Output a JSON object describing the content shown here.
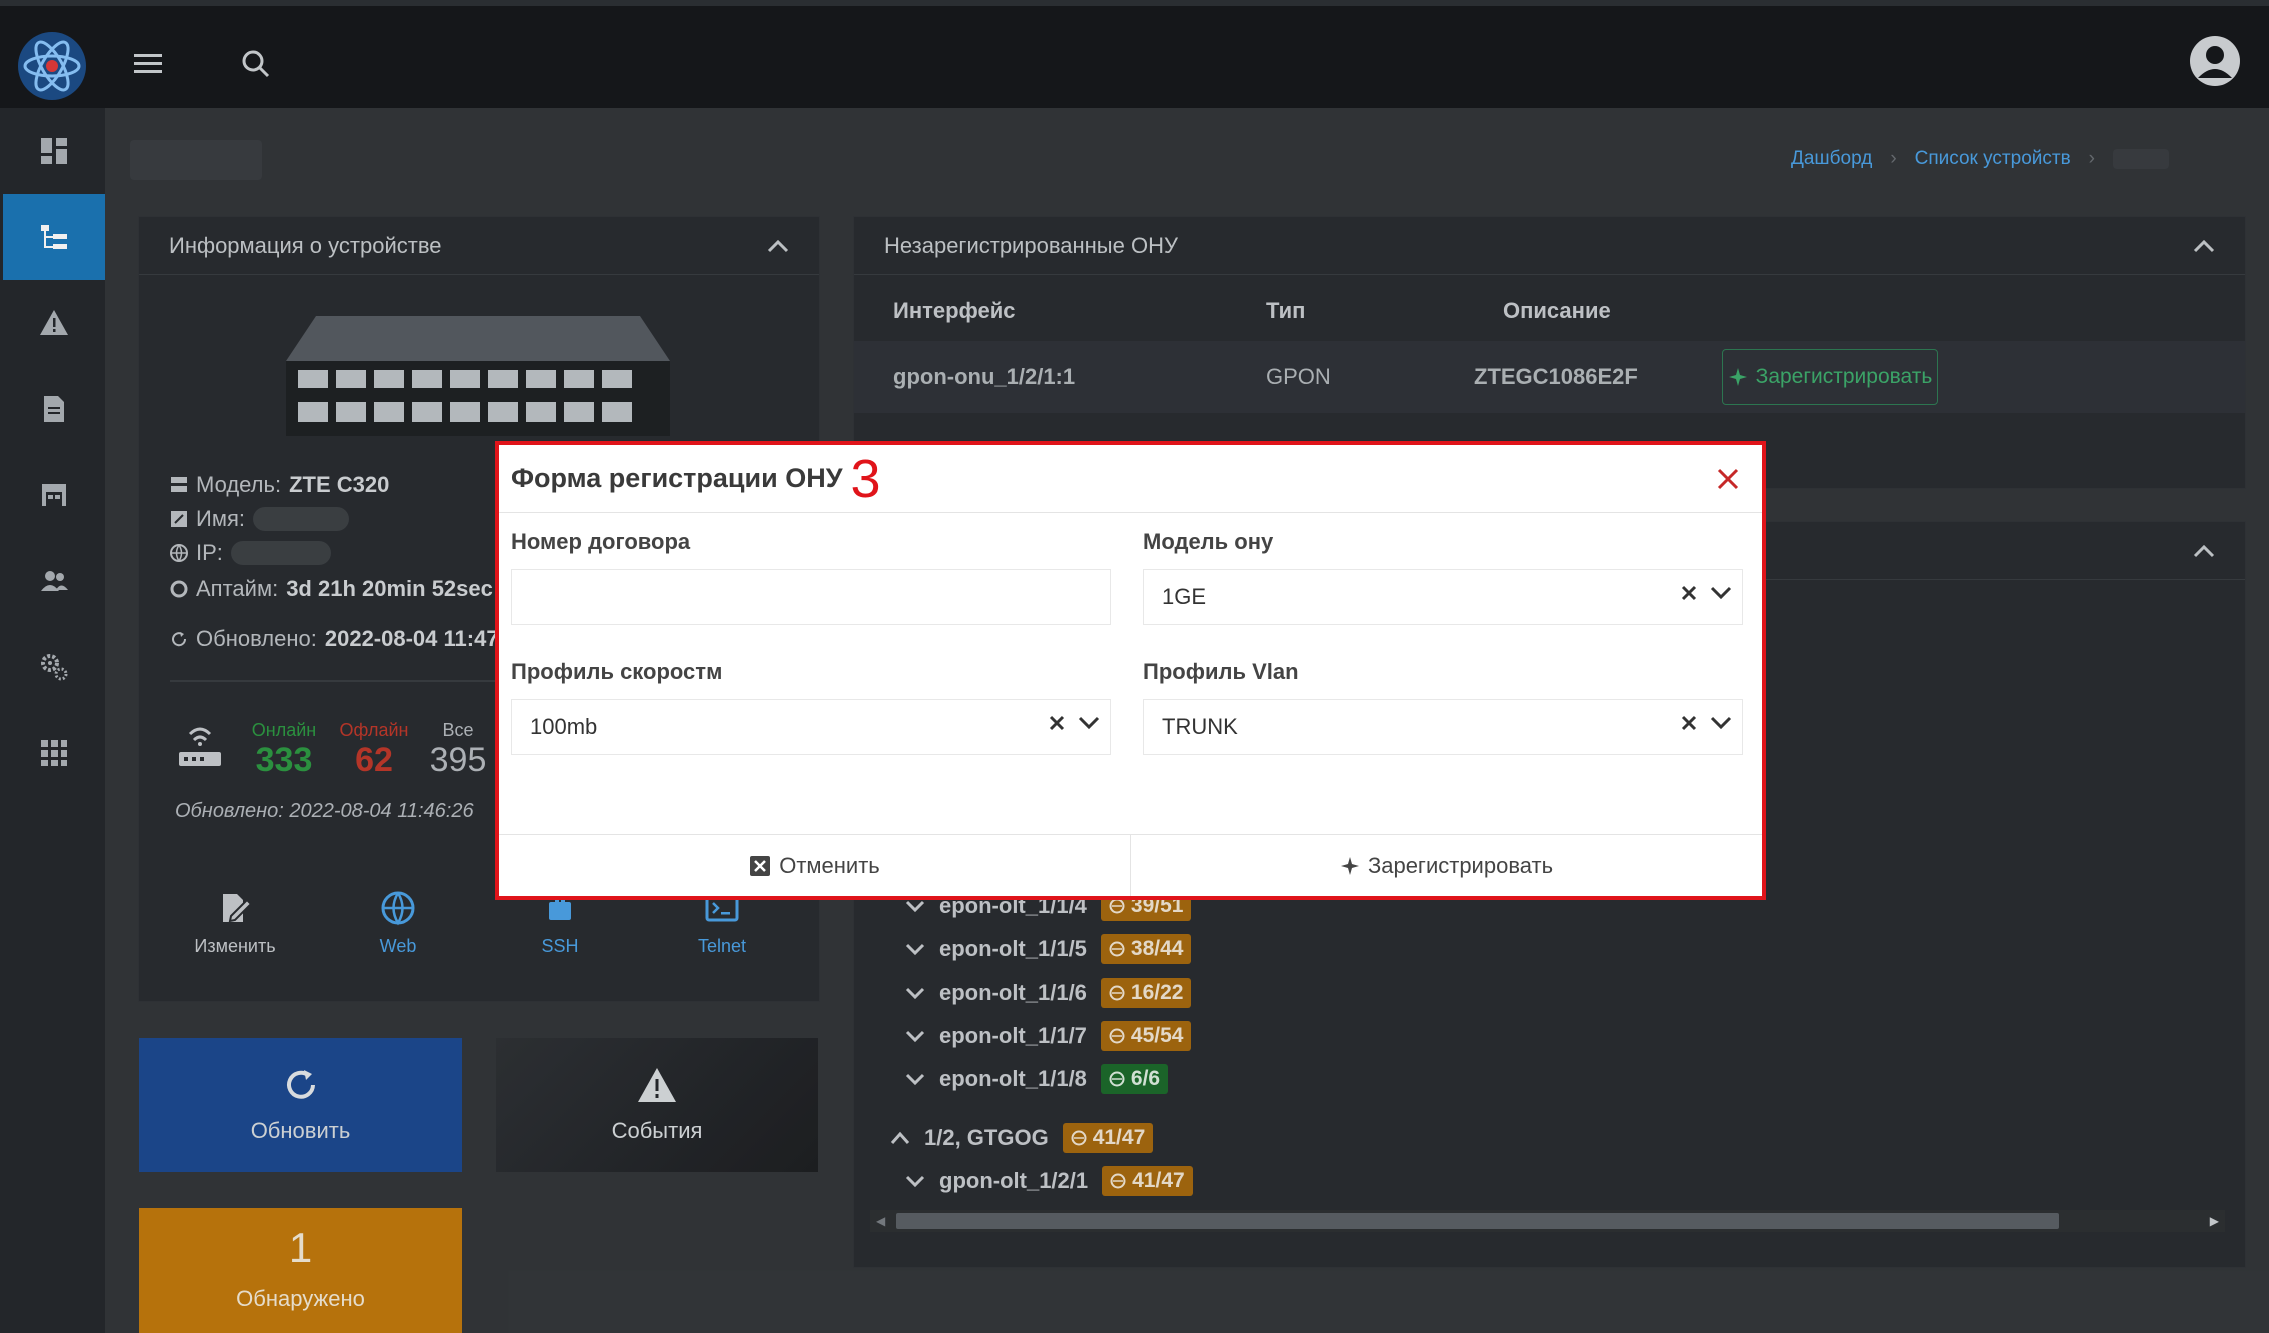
{
  "breadcrumbs": [
    "Дашборд",
    "Список устройств"
  ],
  "device_card": {
    "title": "Информация о устройстве",
    "model_label": "Модель:",
    "model_value": "ZTE C320",
    "name_label": "Имя:",
    "ip_label": "IP:",
    "uptime_label": "Аптайм:",
    "uptime_value": "3d 21h 20min 52sec",
    "updated_label": "Обновлено:",
    "updated_value": "2022-08-04 11:47",
    "stats": {
      "online_label": "Онлайн",
      "online_value": "333",
      "offline_label": "Офлайн",
      "offline_value": "62",
      "all_label": "Все",
      "all_value": "395"
    },
    "stats_updated": "Обновлено: 2022-08-04 11:46:26",
    "actions": [
      "Изменить",
      "Web",
      "SSH",
      "Telnet"
    ]
  },
  "big_buttons": {
    "refresh": "Обновить",
    "events": "События",
    "detected_count": "1",
    "detected_label": "Обнаружено"
  },
  "unregistered": {
    "title": "Незарегистрированные ОНУ",
    "columns": [
      "Интерфейс",
      "Тип",
      "Описание"
    ],
    "row": {
      "interface": "gpon-onu_1/2/1:1",
      "type": "GPON",
      "description": "ZTEGC1086E2F",
      "action": "Зарегистрировать"
    }
  },
  "tree": [
    {
      "label": "epon-olt_1/1/4",
      "badge": "39/51",
      "color": "orange"
    },
    {
      "label": "epon-olt_1/1/5",
      "badge": "38/44",
      "color": "orange"
    },
    {
      "label": "epon-olt_1/1/6",
      "badge": "16/22",
      "color": "orange"
    },
    {
      "label": "epon-olt_1/1/7",
      "badge": "45/54",
      "color": "orange"
    },
    {
      "label": "epon-olt_1/1/8",
      "badge": "6/6",
      "color": "green"
    },
    {
      "label": "1/2, GTGOG",
      "badge": "41/47",
      "color": "orange"
    },
    {
      "label": "gpon-olt_1/2/1",
      "badge": "41/47",
      "color": "orange"
    }
  ],
  "modal": {
    "title": "Форма регистрации ОНУ",
    "annotation": "3",
    "contract_label": "Номер договора",
    "contract_value": "",
    "model_label": "Модель ону",
    "model_value": "1GE",
    "speed_label": "Профиль скоростм",
    "speed_value": "100mb",
    "vlan_label": "Профиль Vlan",
    "vlan_value": "TRUNK",
    "cancel": "Отменить",
    "register": "Зарегистрировать"
  },
  "colors": {
    "accent": "#1c78b8",
    "annotation": "#e0141a",
    "online": "#2e9a43",
    "offline": "#c0392b",
    "orange": "#a66a0f",
    "green": "#1d6b2c"
  }
}
